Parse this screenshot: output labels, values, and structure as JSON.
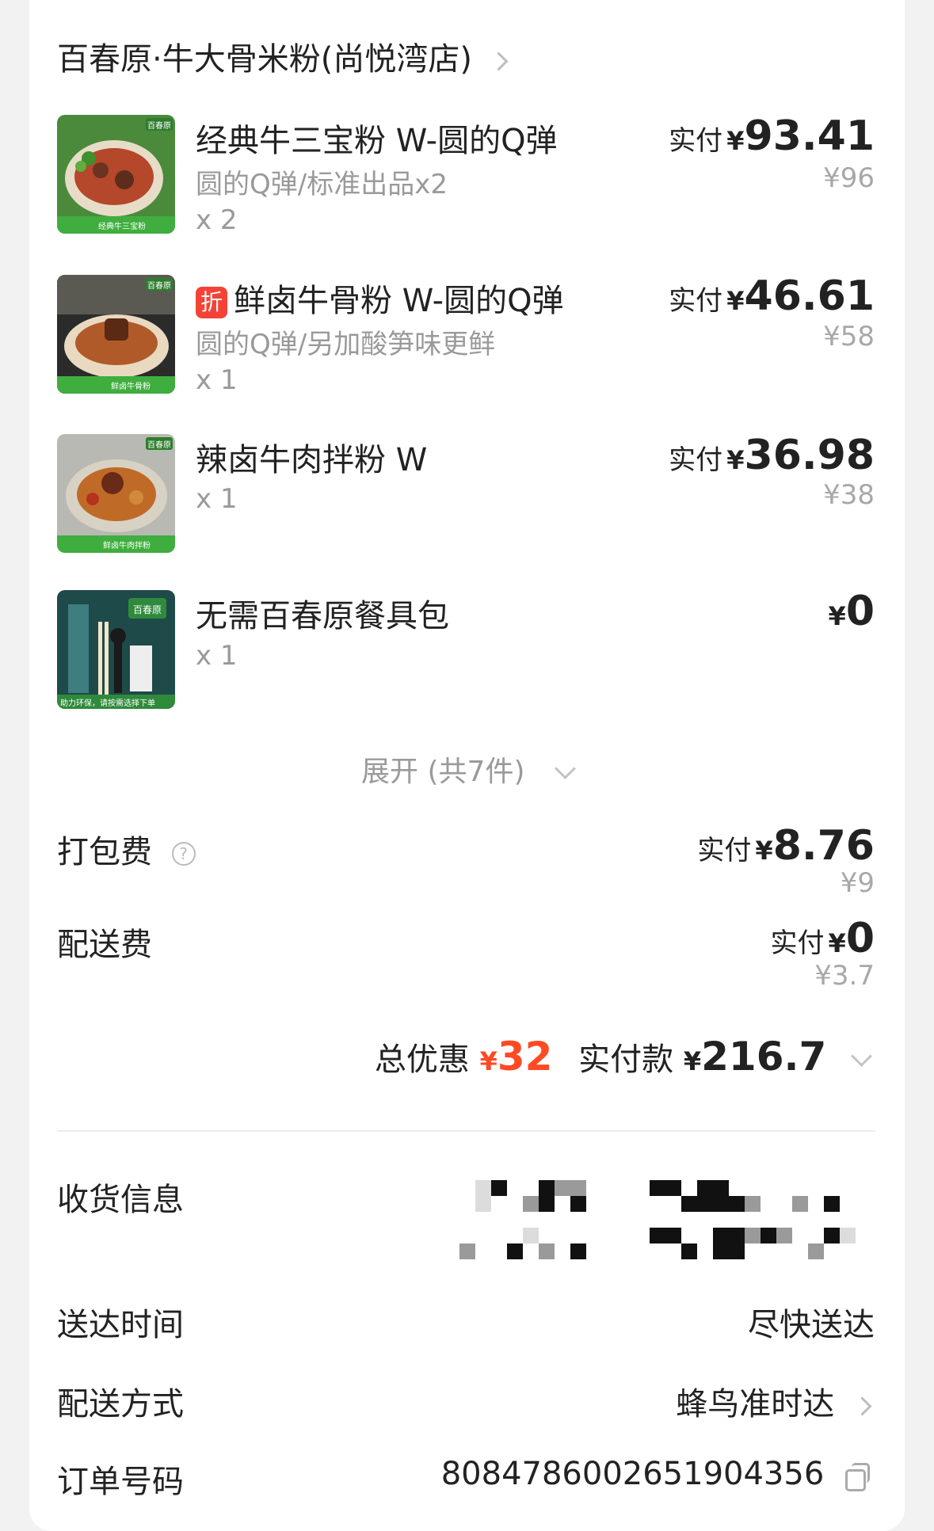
{
  "store": {
    "name": "百春原·牛大骨米粉(尚悦湾店)"
  },
  "items": [
    {
      "name": "经典牛三宝粉 W-圆的Q弹",
      "spec": "圆的Q弹/标准出品x2",
      "qty": "x 2",
      "pay_label": "实付",
      "pay_amount": "93.41",
      "original_price": "¥96",
      "discount_badge": "",
      "thumb_label": "经典牛三宝粉",
      "brand": "百春原"
    },
    {
      "name": "鲜卤牛骨粉 W-圆的Q弹",
      "spec": "圆的Q弹/另加酸笋味更鲜",
      "qty": "x 1",
      "pay_label": "实付",
      "pay_amount": "46.61",
      "original_price": "¥58",
      "discount_badge": "折",
      "thumb_label": "鲜卤牛骨粉",
      "brand": "百春原"
    },
    {
      "name": "辣卤牛肉拌粉 W",
      "spec": "",
      "qty": "x 1",
      "pay_label": "实付",
      "pay_amount": "36.98",
      "original_price": "¥38",
      "discount_badge": "",
      "thumb_label": "鲜卤牛肉拌粉",
      "brand": "百春原"
    },
    {
      "name": "无需百春原餐具包",
      "spec": "",
      "qty": "x 1",
      "pay_label": "",
      "pay_amount": "0",
      "original_price": "",
      "discount_badge": "",
      "thumb_label": "助力环保，请按需选择下单",
      "brand": "百春原"
    }
  ],
  "expand": {
    "label": "展开 (共7件)"
  },
  "fees": {
    "packing": {
      "label": "打包费",
      "pay_label": "实付",
      "pay_amount": "8.76",
      "original": "¥9"
    },
    "delivery": {
      "label": "配送费",
      "pay_label": "实付",
      "pay_amount": "0",
      "original": "¥3.7"
    }
  },
  "summary": {
    "discount_label": "总优惠",
    "discount_amount": "32",
    "paid_label": "实付款",
    "paid_amount": "216.7",
    "currency": "¥"
  },
  "info": {
    "receiver": {
      "label": "收货信息"
    },
    "time": {
      "label": "送达时间",
      "value": "尽快送达"
    },
    "method": {
      "label": "配送方式",
      "value": "蜂鸟准时达"
    },
    "order": {
      "label": "订单号码",
      "value": "8084786002651904356"
    }
  },
  "colors": {
    "accent_red": "#ff4a24",
    "badge_red": "#f44336",
    "thumb_green": "#3fae3f"
  }
}
